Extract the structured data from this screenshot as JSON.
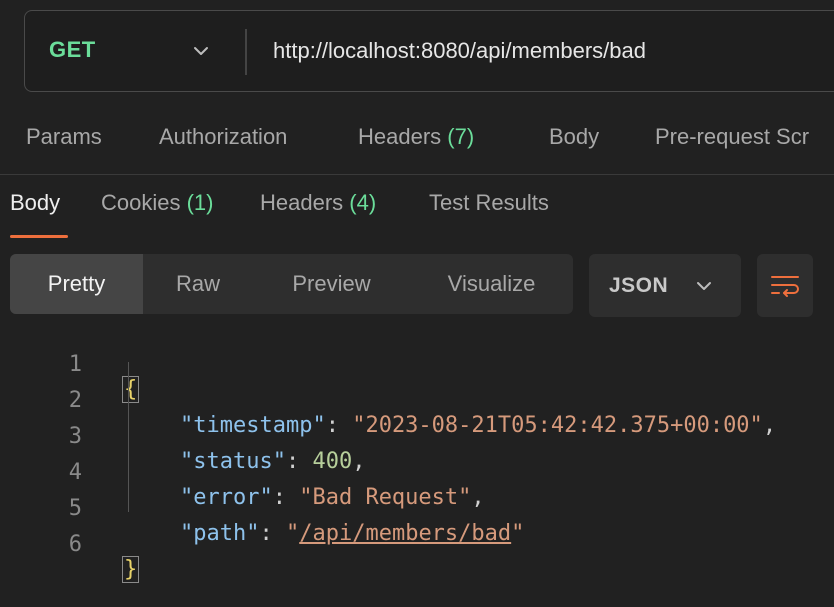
{
  "request": {
    "method": "GET",
    "url": "http://localhost:8080/api/members/bad"
  },
  "request_tabs": [
    {
      "label": "Params",
      "count": ""
    },
    {
      "label": "Authorization",
      "count": ""
    },
    {
      "label": "Headers",
      "count": "(7)"
    },
    {
      "label": "Body",
      "count": ""
    },
    {
      "label": "Pre-request Scr",
      "count": ""
    }
  ],
  "response_tabs": [
    {
      "label": "Body",
      "count": "",
      "active": true
    },
    {
      "label": "Cookies",
      "count": "(1)"
    },
    {
      "label": "Headers",
      "count": "(4)"
    },
    {
      "label": "Test Results",
      "count": ""
    }
  ],
  "view_modes": [
    "Pretty",
    "Raw",
    "Preview",
    "Visualize"
  ],
  "active_view": "Pretty",
  "format": "JSON",
  "code": {
    "line_numbers": [
      "1",
      "2",
      "3",
      "4",
      "5",
      "6"
    ],
    "open_brace": "{",
    "close_brace": "}",
    "fields": [
      {
        "key": "\"timestamp\"",
        "value": "\"2023-08-21T05:42:42.375+00:00\"",
        "type": "string",
        "trail": ","
      },
      {
        "key": "\"status\"",
        "value": "400",
        "type": "number",
        "trail": ","
      },
      {
        "key": "\"error\"",
        "value": "\"Bad Request\"",
        "type": "string",
        "trail": ","
      },
      {
        "key": "\"path\"",
        "value_open": "\"",
        "value_link": "/api/members/bad",
        "value_close": "\"",
        "type": "link",
        "trail": ""
      }
    ]
  },
  "colors": {
    "accent": "#ee6f3d",
    "method": "#6bdd9a",
    "json_key": "#8ec2ec",
    "json_string": "#d69a7c",
    "json_number": "#b7cf9b"
  },
  "icons": {
    "method_dropdown": "chevron-down-icon",
    "format_dropdown": "chevron-down-icon",
    "wrap": "wrap-lines-icon"
  }
}
